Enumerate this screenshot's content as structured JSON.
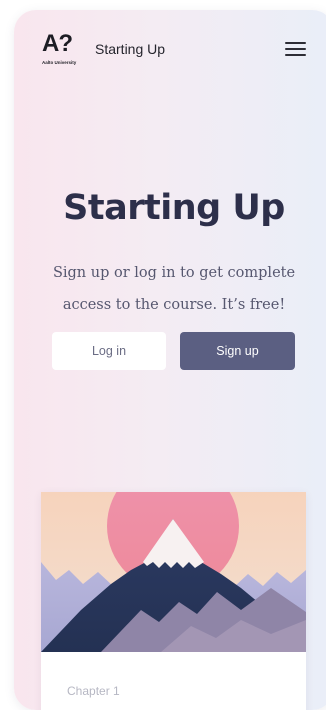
{
  "header": {
    "logo_mark": "A?",
    "logo_subtext": "Aalto University",
    "site_title": "Starting Up"
  },
  "hero": {
    "title": "Starting Up",
    "line1": "Sign up or log in to get complete",
    "line2": "access to the course. It’s free!"
  },
  "buttons": {
    "login_label": "Log in",
    "signup_label": "Sign up"
  },
  "card": {
    "chapter_label": "Chapter 1"
  },
  "colors": {
    "accent": "#5b5f82",
    "title": "#2d2f4a"
  }
}
